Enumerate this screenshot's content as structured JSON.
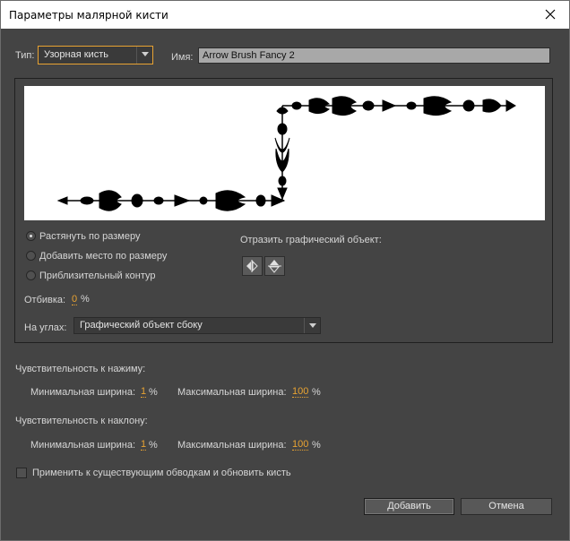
{
  "dialog": {
    "title": "Параметры малярной кисти"
  },
  "type": {
    "label": "Тип:",
    "value": "Узорная кисть"
  },
  "name": {
    "label": "Имя:",
    "value": "Arrow Brush Fancy 2"
  },
  "fit": {
    "options": [
      "Растянуть по размеру",
      "Добавить место по размеру",
      "Приблизительный контур"
    ],
    "selected": 0
  },
  "flip": {
    "label": "Отразить графический объект:"
  },
  "spacing": {
    "label": "Отбивка:",
    "value": "0",
    "unit": "%"
  },
  "corners": {
    "label": "На углах:",
    "value": "Графический объект сбоку"
  },
  "pressure": {
    "title": "Чувствительность к нажиму:",
    "min_label": "Минимальная ширина:",
    "min_value": "1",
    "min_unit": "%",
    "max_label": "Максимальная ширина:",
    "max_value": "100",
    "max_unit": "%"
  },
  "tilt": {
    "title": "Чувствительность к наклону:",
    "min_label": "Минимальная ширина:",
    "min_value": "1",
    "min_unit": "%",
    "max_label": "Максимальная ширина:",
    "max_value": "100",
    "max_unit": "%"
  },
  "apply": {
    "label": "Применить к существующим обводкам и обновить кисть",
    "checked": false
  },
  "buttons": {
    "add": "Добавить",
    "cancel": "Отмена"
  },
  "colors": {
    "background": "#444444",
    "accent_number": "#e8a332",
    "type_border": "#e8a332"
  }
}
